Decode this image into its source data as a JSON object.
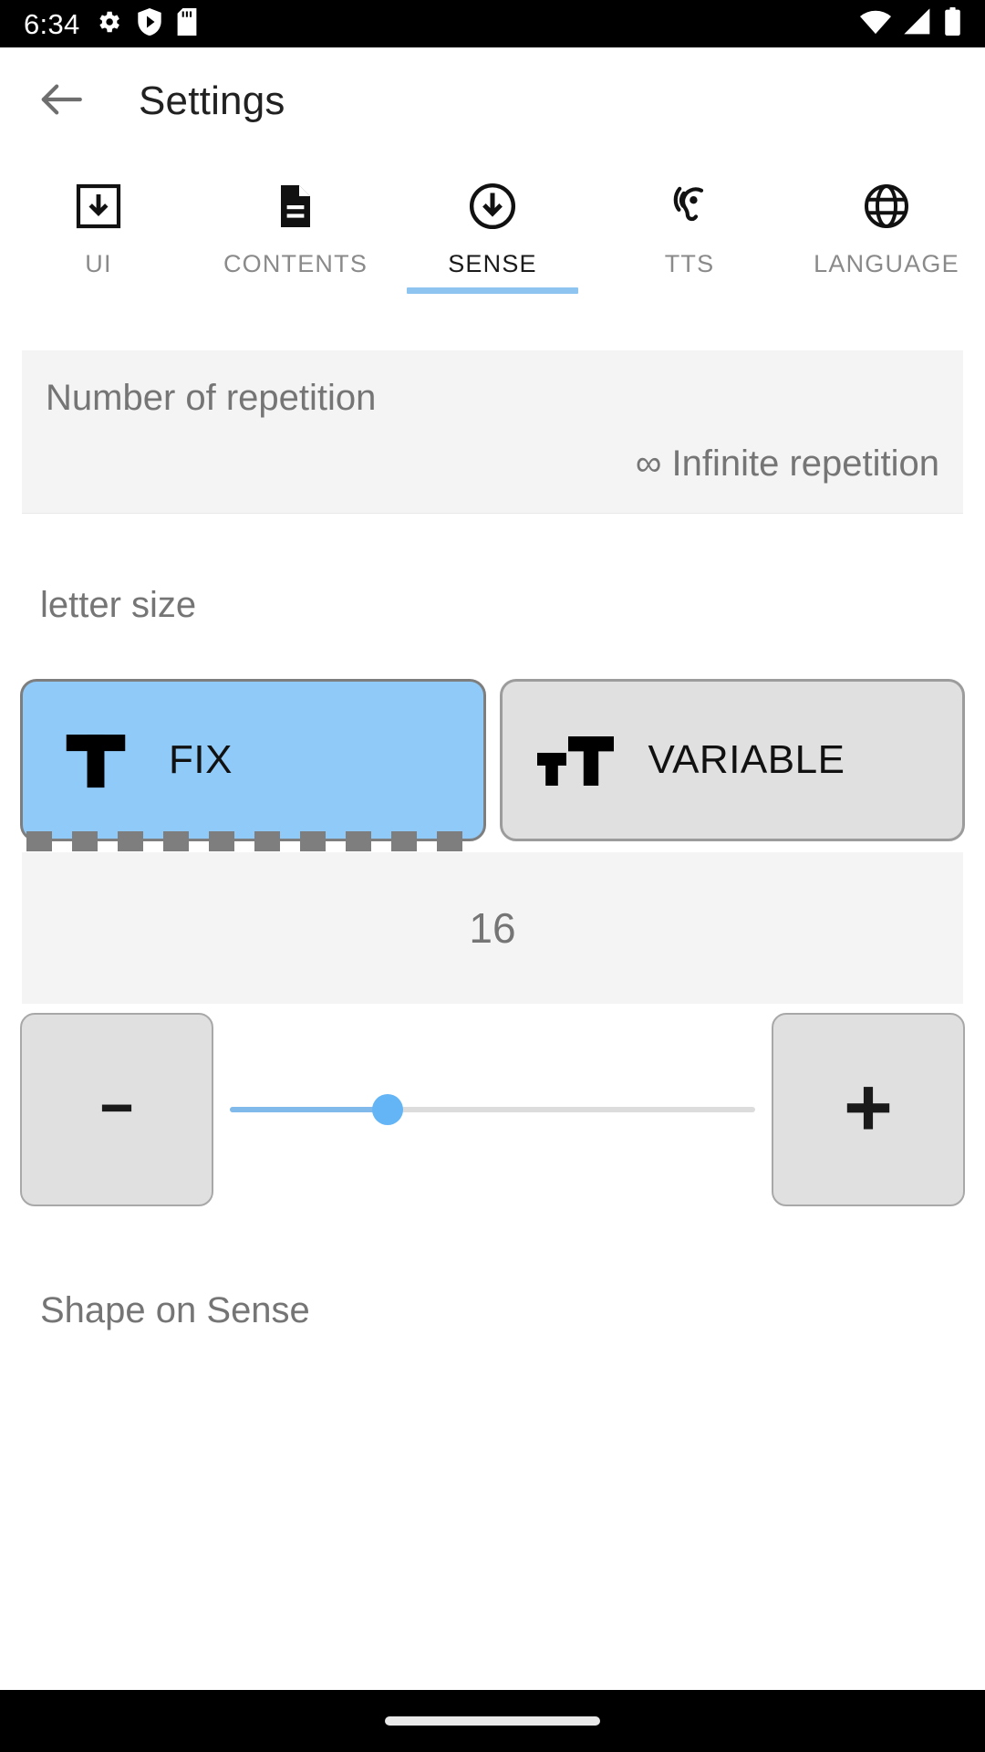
{
  "status_bar": {
    "time": "6:34",
    "left_icons": [
      "gear-icon",
      "play-protect-icon",
      "sd-card-icon"
    ],
    "right_icons": [
      "wifi-icon",
      "cellular-signal-icon",
      "battery-icon"
    ]
  },
  "app_bar": {
    "back_icon": "back-arrow-icon",
    "title": "Settings"
  },
  "tabs": {
    "active_index": 2,
    "indicator_color": "#8ec5f0",
    "items": [
      {
        "label": "UI",
        "icon": "box-download-icon"
      },
      {
        "label": "CONTENTS",
        "icon": "document-icon"
      },
      {
        "label": "SENSE",
        "icon": "circle-download-icon"
      },
      {
        "label": "TTS",
        "icon": "ear-hearing-icon"
      },
      {
        "label": "LANGUAGE",
        "icon": "globe-icon"
      }
    ]
  },
  "repetition": {
    "title": "Number of repetition",
    "value": "∞ Infinite repetition"
  },
  "letter_size": {
    "section_label": "letter size",
    "modes": [
      {
        "label": "FIX",
        "icon": "single-t-icon",
        "selected": true
      },
      {
        "label": "VARIABLE",
        "icon": "double-t-icon",
        "selected": false
      }
    ],
    "value": "16",
    "slider": {
      "percent": 30,
      "fill_color": "#81b9ea",
      "thumb_color": "#64b5f6",
      "track_color": "#dcdcdc"
    },
    "decrement_label": "−",
    "increment_label": "+"
  },
  "shape_section": {
    "label": "Shape on Sense"
  },
  "nav_bar": {
    "home_indicator": "home-indicator-pill"
  },
  "colors": {
    "accent": "#90caf9",
    "panel_bg": "#f4f4f4",
    "text_gray": "#757575",
    "button_gray": "#e0e0e0"
  }
}
